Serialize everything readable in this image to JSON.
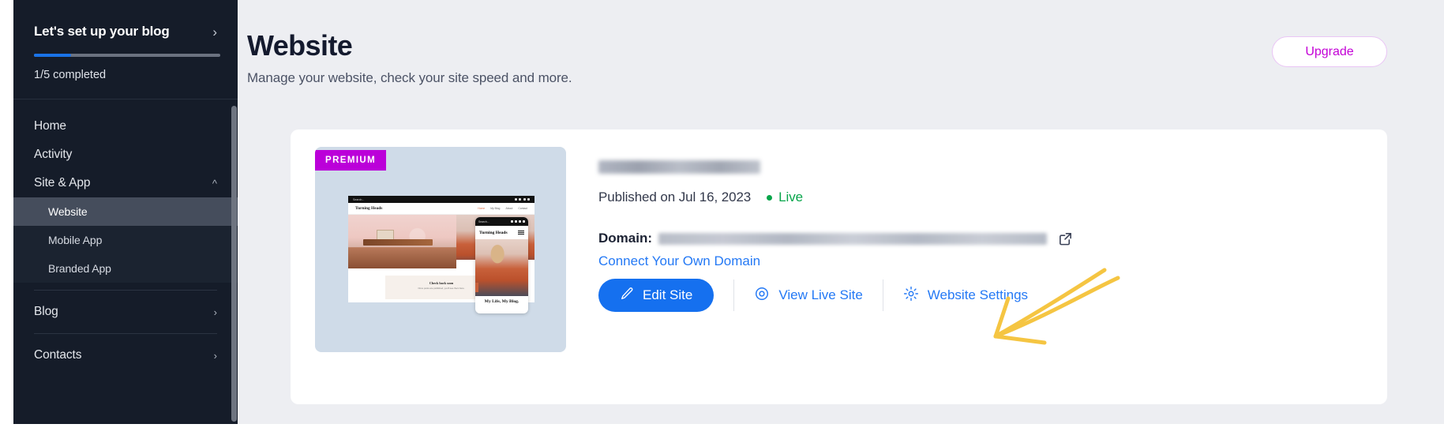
{
  "sidebar": {
    "setup": {
      "title": "Let's set up your blog",
      "chevron": "chevron-right-icon",
      "progress_label": "1/5 completed",
      "progress_percent": 20,
      "progress_fill_color": "#1a73e8"
    },
    "items": [
      {
        "label": "Home",
        "type": "link",
        "active": false
      },
      {
        "label": "Activity",
        "type": "link",
        "active": false
      },
      {
        "label": "Site & App",
        "type": "group",
        "expanded": true,
        "caret": "chevron-up-icon"
      },
      {
        "label": "Website",
        "type": "child",
        "active": true
      },
      {
        "label": "Mobile App",
        "type": "child",
        "active": false
      },
      {
        "label": "Branded App",
        "type": "child",
        "active": false
      },
      {
        "label": "Blog",
        "type": "group",
        "expanded": false,
        "caret": "chevron-right-icon"
      },
      {
        "label": "Contacts",
        "type": "group",
        "expanded": false,
        "caret": "chevron-right-icon"
      }
    ]
  },
  "header": {
    "title": "Website",
    "subtitle": "Manage your website, check your site speed and more.",
    "upgrade_label": "Upgrade",
    "upgrade_color": "#c300d6"
  },
  "card": {
    "thumbnail": {
      "badge": "PREMIUM",
      "badge_color": "#bb00d9",
      "desktop_mock": {
        "search_placeholder": "Search...",
        "logo": "Turning Heads",
        "nav_links": [
          "Home",
          "My Blog",
          "About",
          "Contact"
        ],
        "hero_caption": "My Life, My Blog.",
        "panel_title": "Check back soon",
        "panel_sub": "Once posts are published, you'll see them here."
      },
      "phone_mock": {
        "search_placeholder": "Search...",
        "logo": "Turning Heads",
        "caption": "My Life, My Blog."
      }
    },
    "site_name_redacted": true,
    "published_text": "Published on Jul 16, 2023",
    "status_label": "Live",
    "status_color": "#06a54a",
    "domain_label": "Domain:",
    "domain_value_redacted": true,
    "external_link_icon": "external-link-icon",
    "connect_link": "Connect Your Own Domain",
    "actions": [
      {
        "label": "Edit Site",
        "icon": "pencil-icon",
        "style": "primary"
      },
      {
        "label": "View Live Site",
        "icon": "eye-target-icon",
        "style": "link"
      },
      {
        "label": "Website Settings",
        "icon": "gear-icon",
        "style": "link"
      }
    ]
  },
  "annotation": {
    "type": "arrow",
    "color": "#f5c542",
    "points_to": "Edit Site"
  }
}
